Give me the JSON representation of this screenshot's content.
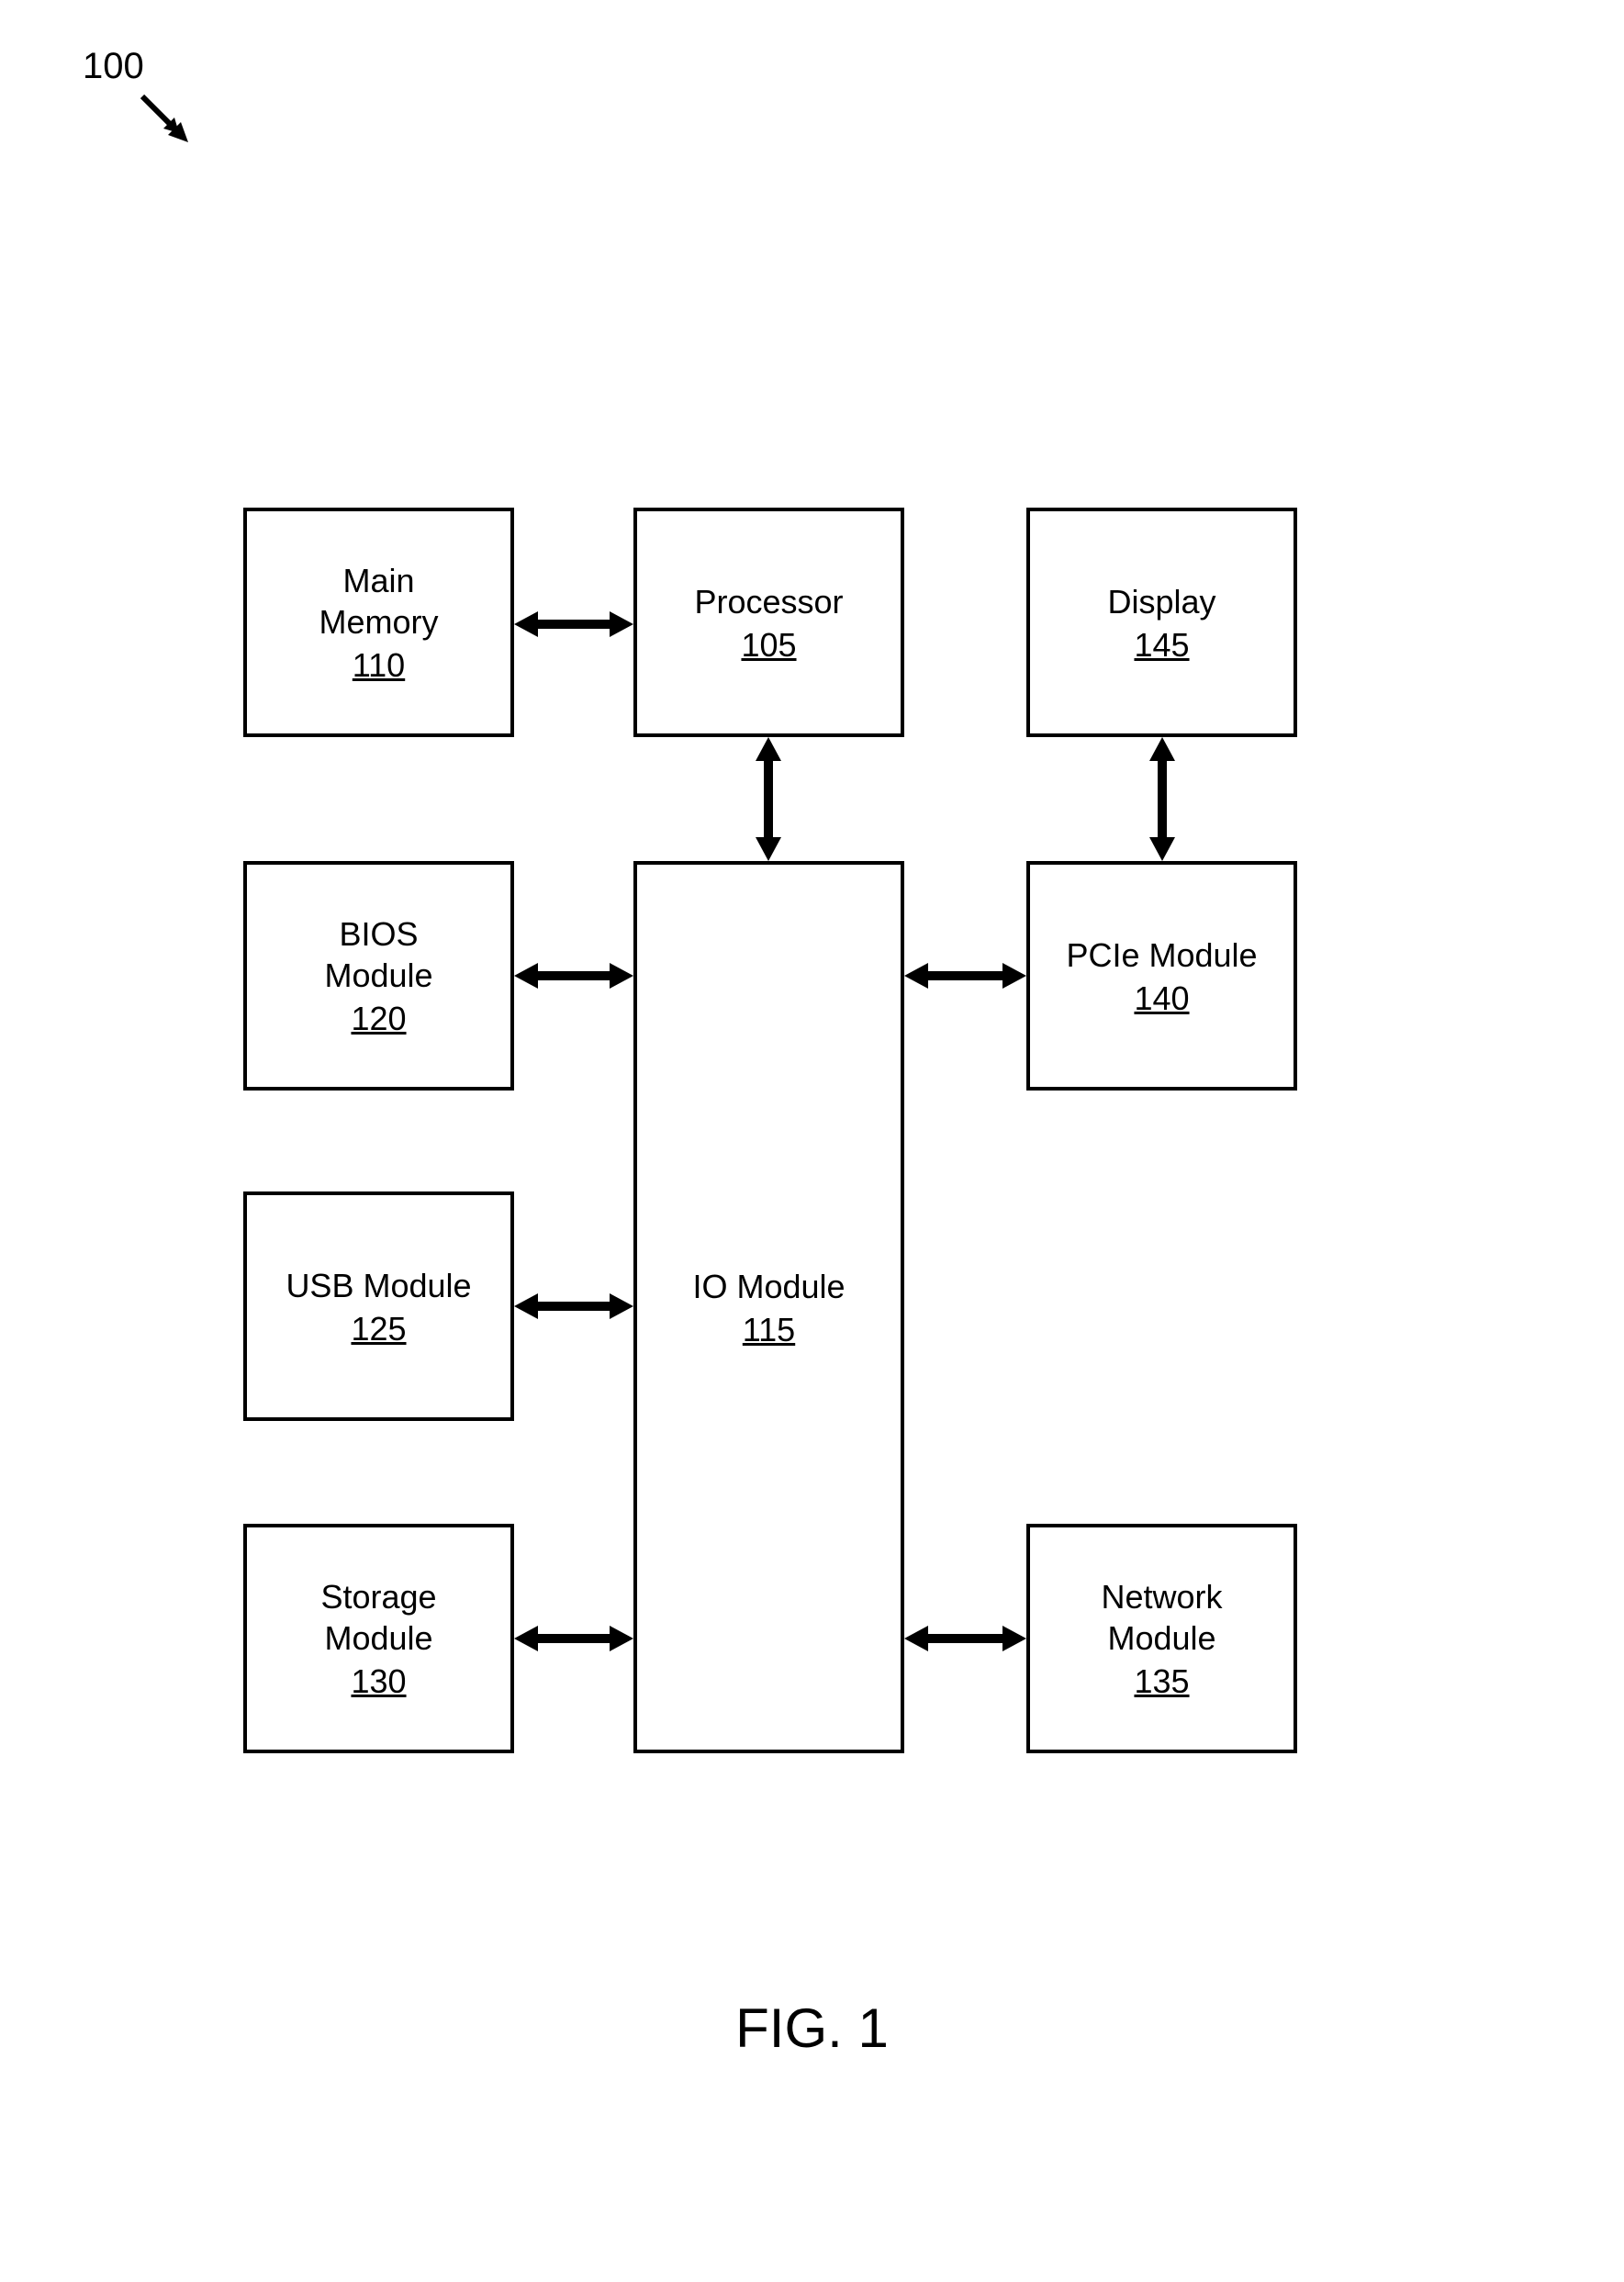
{
  "figure": {
    "ref": "100",
    "caption": "FIG. 1"
  },
  "blocks": {
    "main_memory": {
      "label": "Main\nMemory",
      "num": "110"
    },
    "processor": {
      "label": "Processor",
      "num": "105"
    },
    "display": {
      "label": "Display",
      "num": "145"
    },
    "bios": {
      "label": "BIOS\nModule",
      "num": "120"
    },
    "io": {
      "label": "IO Module",
      "num": "115"
    },
    "pcie": {
      "label": "PCIe Module",
      "num": "140"
    },
    "usb": {
      "label": "USB Module",
      "num": "125"
    },
    "storage": {
      "label": "Storage\nModule",
      "num": "130"
    },
    "network": {
      "label": "Network\nModule",
      "num": "135"
    }
  }
}
